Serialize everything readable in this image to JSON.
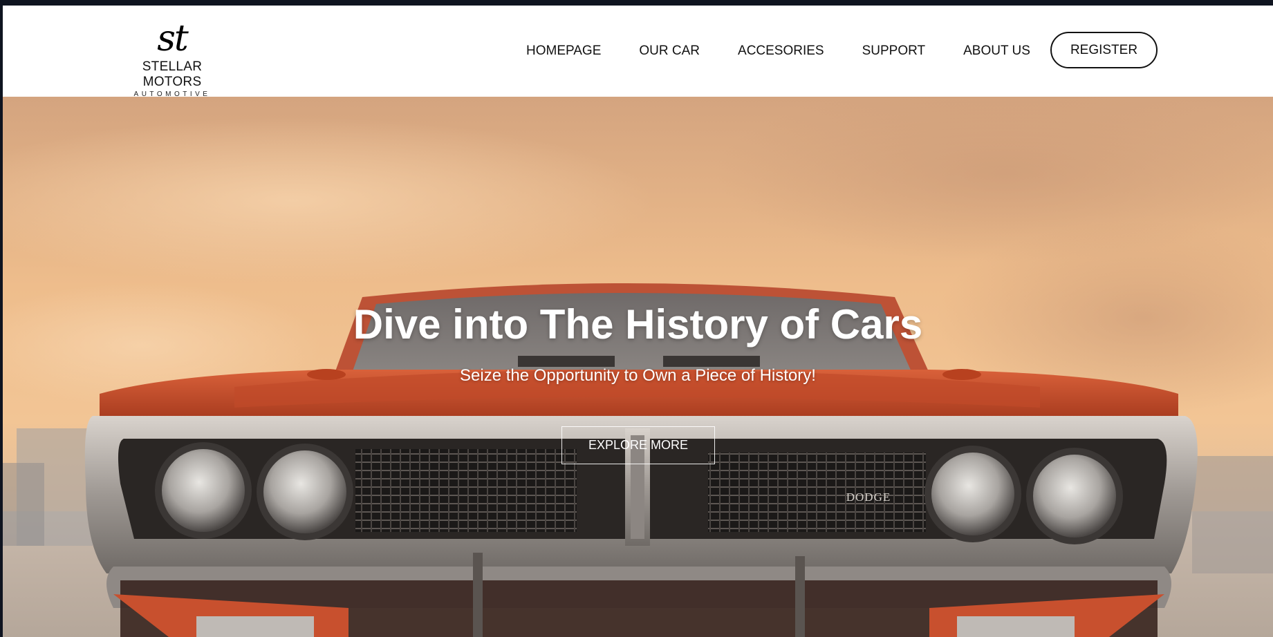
{
  "brand": {
    "mark": "st",
    "name": "STELLAR MOTORS",
    "tagline": "AUTOMOTIVE"
  },
  "nav": {
    "items": [
      {
        "label": "HOMEPAGE"
      },
      {
        "label": "OUR CAR"
      },
      {
        "label": "ACCESORIES"
      },
      {
        "label": "SUPPORT"
      },
      {
        "label": "ABOUT US"
      }
    ],
    "register_label": "REGISTER"
  },
  "hero": {
    "title": "Dive into The History of Cars",
    "subtitle": "Seize the Opportunity to Own a Piece of History!",
    "cta_label": "EXPLORE MORE",
    "badge_text": "DODGE"
  },
  "colors": {
    "header_bg": "#ffffff",
    "nav_text": "#111111",
    "hero_text": "#ffffff",
    "sky": "#ebb888",
    "car_body": "#c8502e",
    "chrome": "#b9b4b0"
  }
}
